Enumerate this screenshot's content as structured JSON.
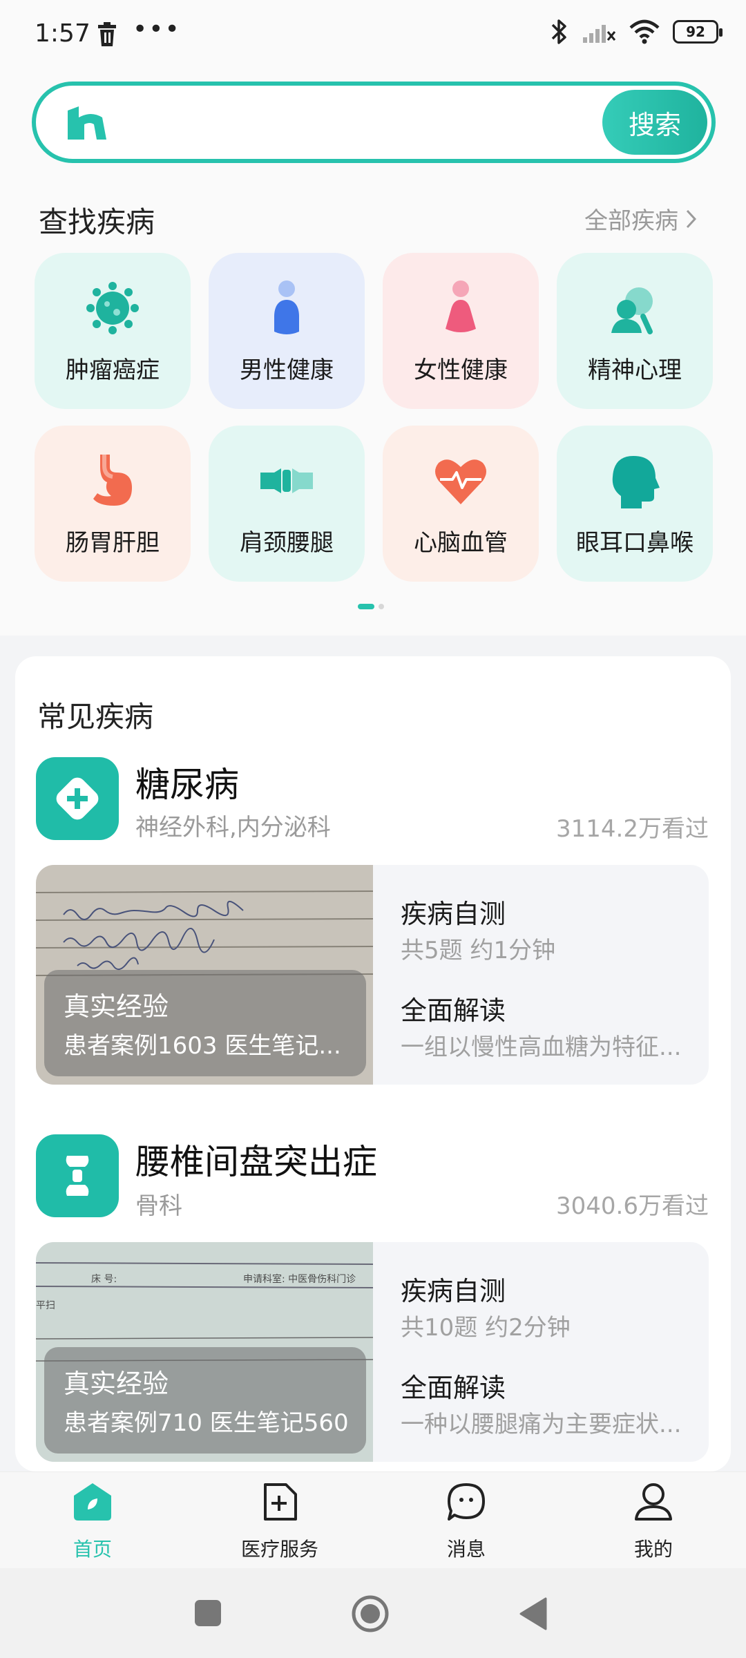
{
  "status": {
    "time": "1:57",
    "battery": "92"
  },
  "search": {
    "button_label": "搜索"
  },
  "find": {
    "title": "查找疾病",
    "more": "全部疾病",
    "categories": [
      {
        "label": "肿瘤癌症",
        "icon": "virus-icon"
      },
      {
        "label": "男性健康",
        "icon": "male-icon"
      },
      {
        "label": "女性健康",
        "icon": "female-icon"
      },
      {
        "label": "精神心理",
        "icon": "mind-icon"
      },
      {
        "label": "肠胃肝胆",
        "icon": "stomach-icon"
      },
      {
        "label": "肩颈腰腿",
        "icon": "bone-icon"
      },
      {
        "label": "心脑血管",
        "icon": "heart-icon"
      },
      {
        "label": "眼耳口鼻喉",
        "icon": "head-icon"
      }
    ]
  },
  "common": {
    "title": "常见疾病",
    "diseases": [
      {
        "name": "糖尿病",
        "dept": "神经外科,内分泌科",
        "views": "3114.2万看过",
        "overlay_title": "真实经验",
        "overlay_sub": "患者案例1603 医生笔记...",
        "self_test_title": "疾病自测",
        "self_test_sub": "共5题 约1分钟",
        "read_title": "全面解读",
        "read_sub": "一组以慢性高血糖为特征..."
      },
      {
        "name": "腰椎间盘突出症",
        "dept": "骨科",
        "views": "3040.6万看过",
        "overlay_title": "真实经验",
        "overlay_sub": "患者案例710 医生笔记560",
        "self_test_title": "疾病自测",
        "self_test_sub": "共10题 约2分钟",
        "read_title": "全面解读",
        "read_sub": "一种以腰腿痛为主要症状..."
      }
    ]
  },
  "nav": {
    "items": [
      {
        "label": "首页",
        "icon": "home-icon"
      },
      {
        "label": "医疗服务",
        "icon": "medical-service-icon"
      },
      {
        "label": "消息",
        "icon": "message-icon"
      },
      {
        "label": "我的",
        "icon": "profile-icon"
      }
    ]
  },
  "colors": {
    "accent": "#27c2ad",
    "text": "#1b1b1b",
    "muted": "#9a9a9a"
  }
}
